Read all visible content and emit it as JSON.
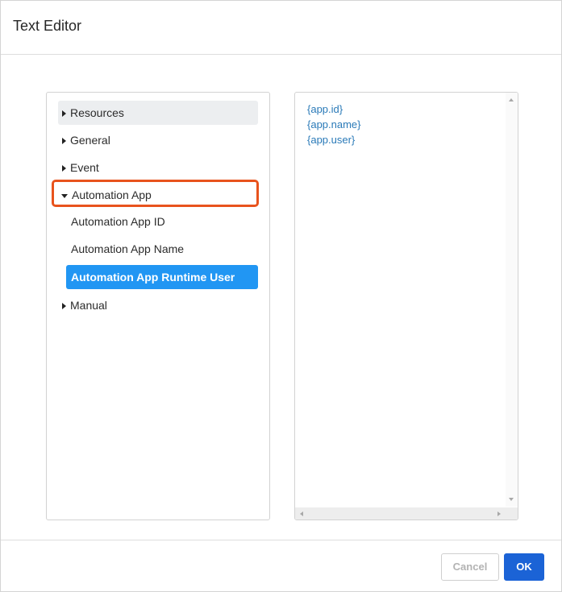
{
  "dialog": {
    "title": "Text Editor"
  },
  "tree": {
    "items": [
      {
        "label": "Resources",
        "state": "collapsed",
        "hovered": true
      },
      {
        "label": "General",
        "state": "collapsed"
      },
      {
        "label": "Event",
        "state": "collapsed"
      },
      {
        "label": "Automation App",
        "state": "expanded",
        "highlighted": true,
        "children": [
          {
            "label": "Automation App ID"
          },
          {
            "label": "Automation App Name"
          },
          {
            "label": "Automation App Runtime User",
            "selected": true
          }
        ]
      },
      {
        "label": "Manual",
        "state": "collapsed"
      }
    ]
  },
  "editor": {
    "lines": [
      "{app.id}",
      "{app.name}",
      "{app.user}"
    ]
  },
  "footer": {
    "cancel_label": "Cancel",
    "ok_label": "OK"
  },
  "colors": {
    "selected": "#2196f3",
    "highlight_border": "#e8531d",
    "token_text": "#2a7ab8",
    "primary_button": "#1b63d6"
  }
}
